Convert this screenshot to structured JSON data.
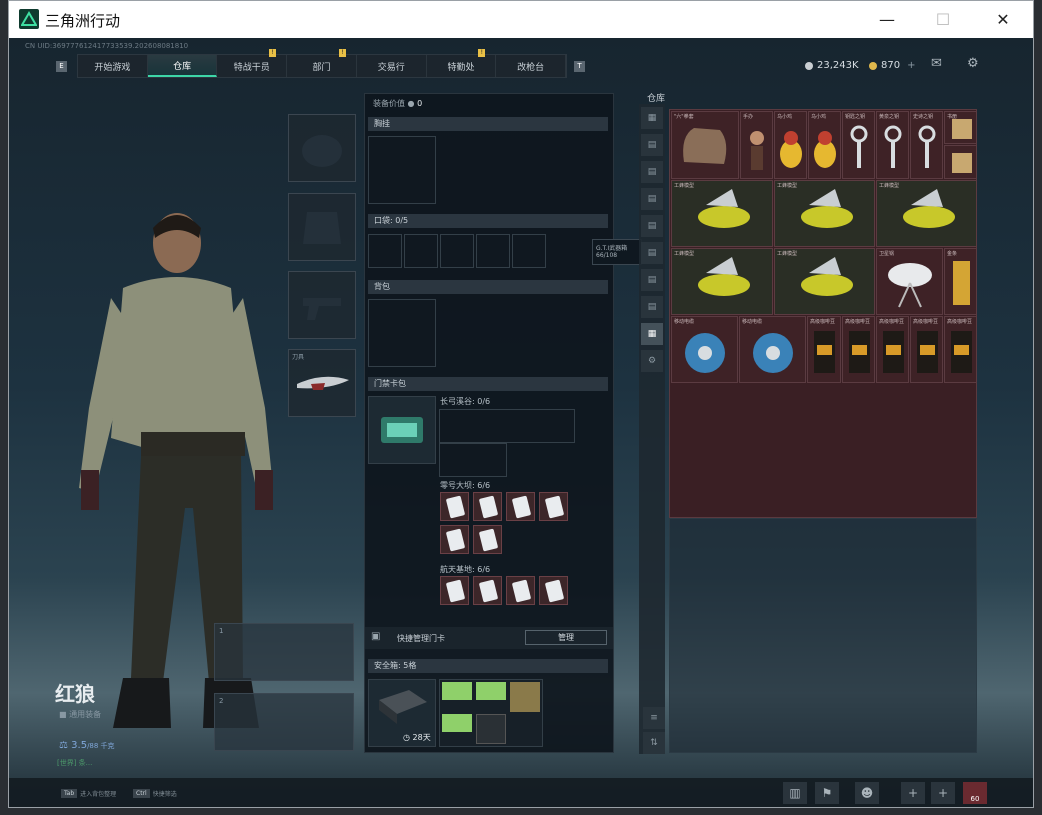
{
  "window": {
    "title": "三角洲行动",
    "minimize": "—",
    "maximize": "☐",
    "close": "✕"
  },
  "uid": "CN UID:369777612417733539.202608081810",
  "nav": {
    "left_arrow": "E",
    "right_arrow": "T",
    "tabs": [
      {
        "label": "开始游戏",
        "badge": ""
      },
      {
        "label": "仓库",
        "badge": ""
      },
      {
        "label": "特战干员",
        "badge": "!"
      },
      {
        "label": "部门",
        "badge": "!"
      },
      {
        "label": "交易行",
        "badge": ""
      },
      {
        "label": "特勤处",
        "badge": "!"
      },
      {
        "label": "改枪台",
        "badge": ""
      }
    ]
  },
  "currency": {
    "coin_a": "23,243K",
    "coin_b": "870",
    "plus": "+"
  },
  "operator": {
    "name": "红狼",
    "sub": "通用装备",
    "level": "3.5",
    "level_suffix": "/88 千克",
    "chat": "[世界] 条..."
  },
  "gear": {
    "knife_label": "刀具"
  },
  "equipment": {
    "value_label": "装备价值",
    "value": "0",
    "chest_rig": "胸挂",
    "pocket": "口袋: 0/5",
    "backpack": "背包",
    "keycard_pack": "门禁卡包",
    "tooltip_title": "G.T.I武器箱",
    "tooltip_value": "66/108",
    "zones": [
      {
        "name": "长弓溪谷: 0/6"
      },
      {
        "name": "零号大坝: 6/6"
      },
      {
        "name": "航天基地: 6/6"
      }
    ],
    "quick_manage": "快捷管理门卡",
    "manage_btn": "管理",
    "safebox": "安全箱: 5格",
    "safe_days": "28天"
  },
  "stash": {
    "title": "仓库",
    "row1": [
      "\"六\"拳套",
      "手办",
      "乌小鸡",
      "乌小鸡",
      "钥匙之钥",
      "黄泉之钥",
      "史诗之钥",
      "书册"
    ],
    "wasp": "工蜂模型",
    "dish": "卫星锅",
    "gold": "金条",
    "reel": "移动电缆",
    "coffee": "高级咖啡豆",
    "ammo": "高级咖啡豆"
  },
  "bottom": {
    "k1": "Tab",
    "k1_text": "进入背包整理",
    "k2": "Ctrl",
    "k2_text": "快捷筛选",
    "count": "60"
  }
}
